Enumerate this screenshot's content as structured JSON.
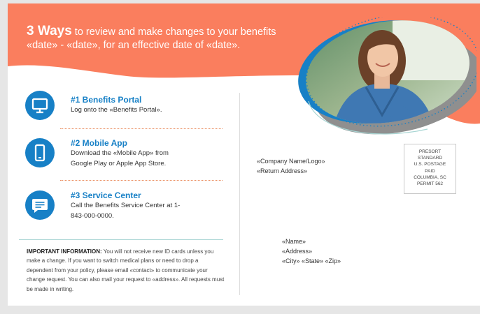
{
  "header": {
    "headline_bold": "3 Ways",
    "headline_rest_1": " to review and make changes to your benefits",
    "headline_line2": "«date» - «date», for an effective date of «date».",
    "photo_icon": "smiling-woman-photo-icon"
  },
  "options": [
    {
      "icon": "monitor-icon",
      "title": "#1 Benefits Portal",
      "desc": "Log onto the «Benefits Portal»."
    },
    {
      "icon": "mobile-phone-icon",
      "title": "#2 Mobile App",
      "desc": "Download the «Mobile App» from Google Play or Apple App Store."
    },
    {
      "icon": "chat-bubble-icon",
      "title": "#3 Service Center",
      "desc": "Call the Benefits Service Center at 1-843-000-0000."
    }
  ],
  "important": {
    "label": "IMPORTANT INFORMATION:",
    "text": " You will not receive new ID cards unless you make a change. If you want to switch medical plans or need to drop a dependent from your policy, please email «contact» to communicate your change request. You can also mail your request to «address». All requests must be made in writing."
  },
  "sender": {
    "company": "«Company Name/Logo»",
    "return_address": "«Return Address»"
  },
  "postage": {
    "line1": "PRESORT",
    "line2": "STANDARD",
    "line3": "U.S. POSTAGE",
    "line4": "PAID",
    "line5": "COLUMBIA, SC",
    "line6": "PERMIT 562"
  },
  "recipient": {
    "name": "«Name»",
    "address": "«Address»",
    "city_state_zip": "«City» «State» «Zip»"
  },
  "colors": {
    "header_orange": "#fa7e5e",
    "accent_blue": "#1780c6",
    "divider_teal": "#a8d5d3",
    "dotted_orange": "#e98a5a"
  }
}
